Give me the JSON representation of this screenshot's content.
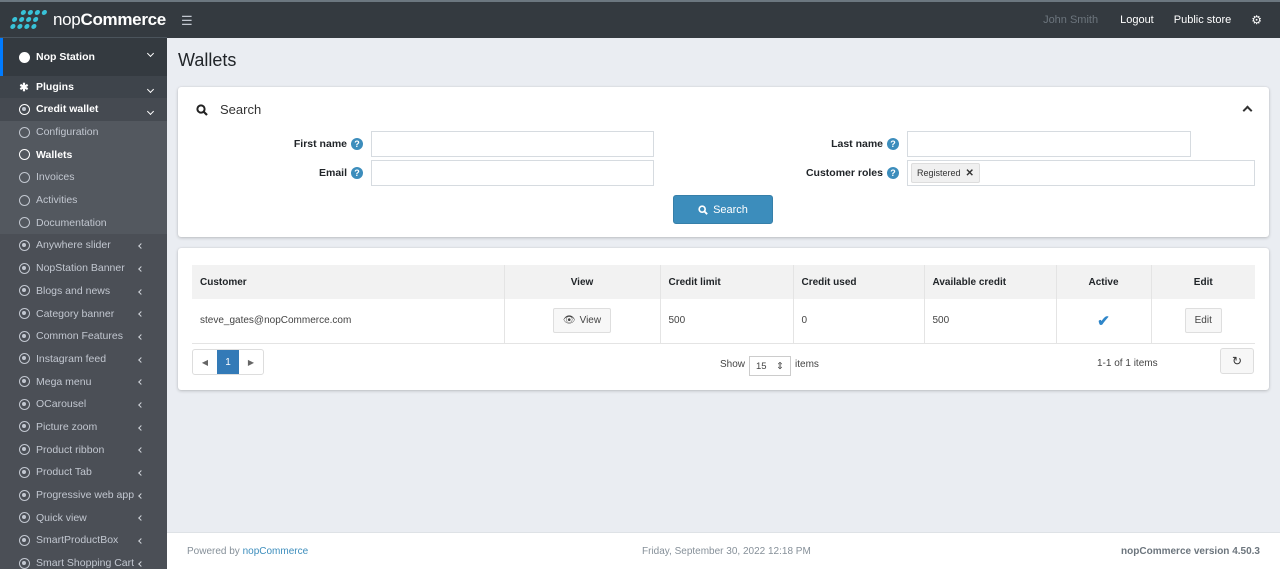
{
  "brand": {
    "logo_light": "nop",
    "logo_bold": "Commerce"
  },
  "topbar": {
    "menu_icon": "hamburger-icon",
    "user_name": "John Smith",
    "logout": "Logout",
    "public_store": "Public store",
    "settings_icon": "gears-icon"
  },
  "sidebar": {
    "top": {
      "label": "Nop Station",
      "icon": "nop-station-icon"
    },
    "plugins": {
      "label": "Plugins",
      "icon": "puzzle-icon"
    },
    "credit_wallet": {
      "label": "Credit wallet",
      "icon": "dot-circle-icon"
    },
    "sub_items": [
      {
        "label": "Configuration",
        "active": false
      },
      {
        "label": "Wallets",
        "active": true
      },
      {
        "label": "Invoices",
        "active": false
      },
      {
        "label": "Activities",
        "active": false
      },
      {
        "label": "Documentation",
        "active": false
      }
    ],
    "items": [
      {
        "label": "Anywhere slider"
      },
      {
        "label": "NopStation Banner"
      },
      {
        "label": "Blogs and news"
      },
      {
        "label": "Category banner"
      },
      {
        "label": "Common Features"
      },
      {
        "label": "Instagram feed"
      },
      {
        "label": "Mega menu"
      },
      {
        "label": "OCarousel"
      },
      {
        "label": "Picture zoom"
      },
      {
        "label": "Product ribbon"
      },
      {
        "label": "Product Tab"
      },
      {
        "label": "Progressive web app"
      },
      {
        "label": "Quick view"
      },
      {
        "label": "SmartProductBox"
      },
      {
        "label": "Smart Shopping Cart"
      }
    ]
  },
  "page": {
    "title": "Wallets"
  },
  "search": {
    "heading": "Search",
    "first_name": {
      "label": "First name",
      "value": ""
    },
    "last_name": {
      "label": "Last name",
      "value": ""
    },
    "email": {
      "label": "Email",
      "value": ""
    },
    "customer_roles": {
      "label": "Customer roles",
      "selected": [
        "Registered"
      ]
    },
    "button": "Search"
  },
  "grid": {
    "columns": [
      "Customer",
      "View",
      "Credit limit",
      "Credit used",
      "Available credit",
      "Active",
      "Edit"
    ],
    "rows": [
      {
        "customer": "steve_gates@nopCommerce.com",
        "view_label": "View",
        "credit_limit": "500",
        "credit_used": "0",
        "available_credit": "500",
        "active": true,
        "edit_label": "Edit"
      }
    ],
    "pager": {
      "current_page": "1",
      "show_label": "Show",
      "page_size": "15",
      "items_label": "items",
      "summary": "1-1 of 1 items"
    }
  },
  "footer": {
    "powered_prefix": "Powered by",
    "powered_link": "nopCommerce",
    "datetime": "Friday, September 30, 2022 12:18 PM",
    "version": "nopCommerce version 4.50.3"
  }
}
